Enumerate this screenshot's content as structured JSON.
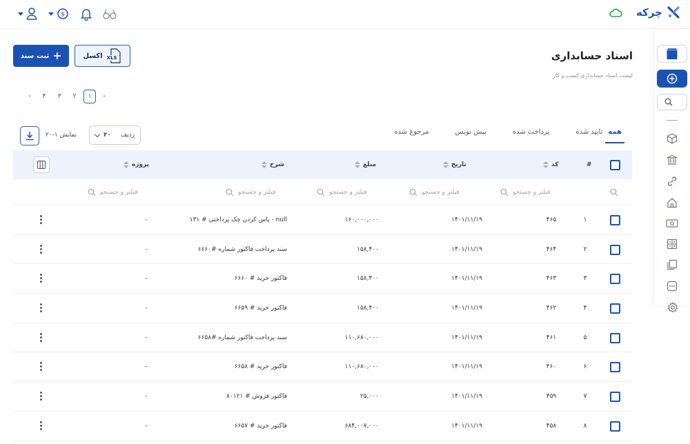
{
  "app": {
    "brand": "چرکه"
  },
  "page": {
    "title": "اسناد حسابداری",
    "subtitle": "لیست اسناد حسابداری کسب و کار"
  },
  "actions": {
    "new_doc": "ثبت سند",
    "excel": "اکسل",
    "excel_badge": "XLS"
  },
  "pagination": {
    "pages": [
      "۱",
      "۲",
      "۳",
      "۴"
    ],
    "active": "۱"
  },
  "tabs": [
    "همه",
    "تایید شده",
    "پرداخت شده",
    "پیش نویس",
    "مرجوع شده"
  ],
  "controls": {
    "show_label": "نمایش ۱-۲۰",
    "rows_label": "ردیف",
    "rows_value": "۲۰"
  },
  "table": {
    "headers": {
      "index": "#",
      "code": "کد",
      "date": "تاریخ",
      "amount": "مبلغ",
      "desc": "شرح",
      "project": "پروژه"
    },
    "filter_placeholder": "فیلتر و جستجو",
    "rows": [
      {
        "index": "۱",
        "code": "۴۶۵",
        "date": "۱۴۰۱/۱۱/۱۹",
        "amount": "۱۶۰,۰۰۰,۰۰۰",
        "desc": "پاس کردن چک پرداختی # ۱۳۱ - null",
        "project": "-"
      },
      {
        "index": "۲",
        "code": "۴۶۴",
        "date": "۱۴۰۱/۱۱/۱۹",
        "amount": "۱۵۸,۴۰۰",
        "desc": "سند پرداخت فاکتور شماره #۶۶۶۰",
        "project": "-"
      },
      {
        "index": "۳",
        "code": "۴۶۳",
        "date": "۱۴۰۱/۱۱/۱۹",
        "amount": "۱۵۸,۴۰۰",
        "desc": "فاکتور خرید # ۶۶۶۰",
        "project": "-"
      },
      {
        "index": "۴",
        "code": "۴۶۲",
        "date": "۱۴۰۱/۱۱/۱۹",
        "amount": "۱۵۸,۴۰۰",
        "desc": "فاکتور خرید # ۶۶۵۹",
        "project": "-"
      },
      {
        "index": "۵",
        "code": "۴۶۱",
        "date": "۱۴۰۱/۱۱/۱۹",
        "amount": "۱۱۰,۶۸۰,۰۰۰",
        "desc": "سند پرداخت فاکتور شماره #۶۶۵۸",
        "project": "-"
      },
      {
        "index": "۶",
        "code": "۴۶۰",
        "date": "۱۴۰۱/۱۱/۱۹",
        "amount": "۱۱۰,۶۸۰,۰۰۰",
        "desc": "فاکتور خرید # ۶۶۵۸",
        "project": "-"
      },
      {
        "index": "۷",
        "code": "۴۵۹",
        "date": "۱۴۰۱/۱۱/۱۹",
        "amount": "۲۵,۰۰۰",
        "desc": "فاکتور فروش # ۸۰۱۲۱",
        "project": "-"
      },
      {
        "index": "۸",
        "code": "۴۵۸",
        "date": "۱۴۰۱/۱۱/۱۹",
        "amount": "۶۸۴,۰۰۷,۰۰۰",
        "desc": "فاکتور خرید # ۶۶۵۷",
        "project": "-"
      }
    ]
  },
  "colors": {
    "primary": "#1a52b3",
    "header_bg": "#edf3fc",
    "cloud": "#22a845"
  },
  "icons": [
    "logo-icon",
    "cloud-icon",
    "bell-icon",
    "glasses-icon",
    "coin-icon",
    "user-icon",
    "plus-icon",
    "excel-icon",
    "download-icon",
    "columns-icon",
    "search-icon",
    "kebab-icon"
  ]
}
